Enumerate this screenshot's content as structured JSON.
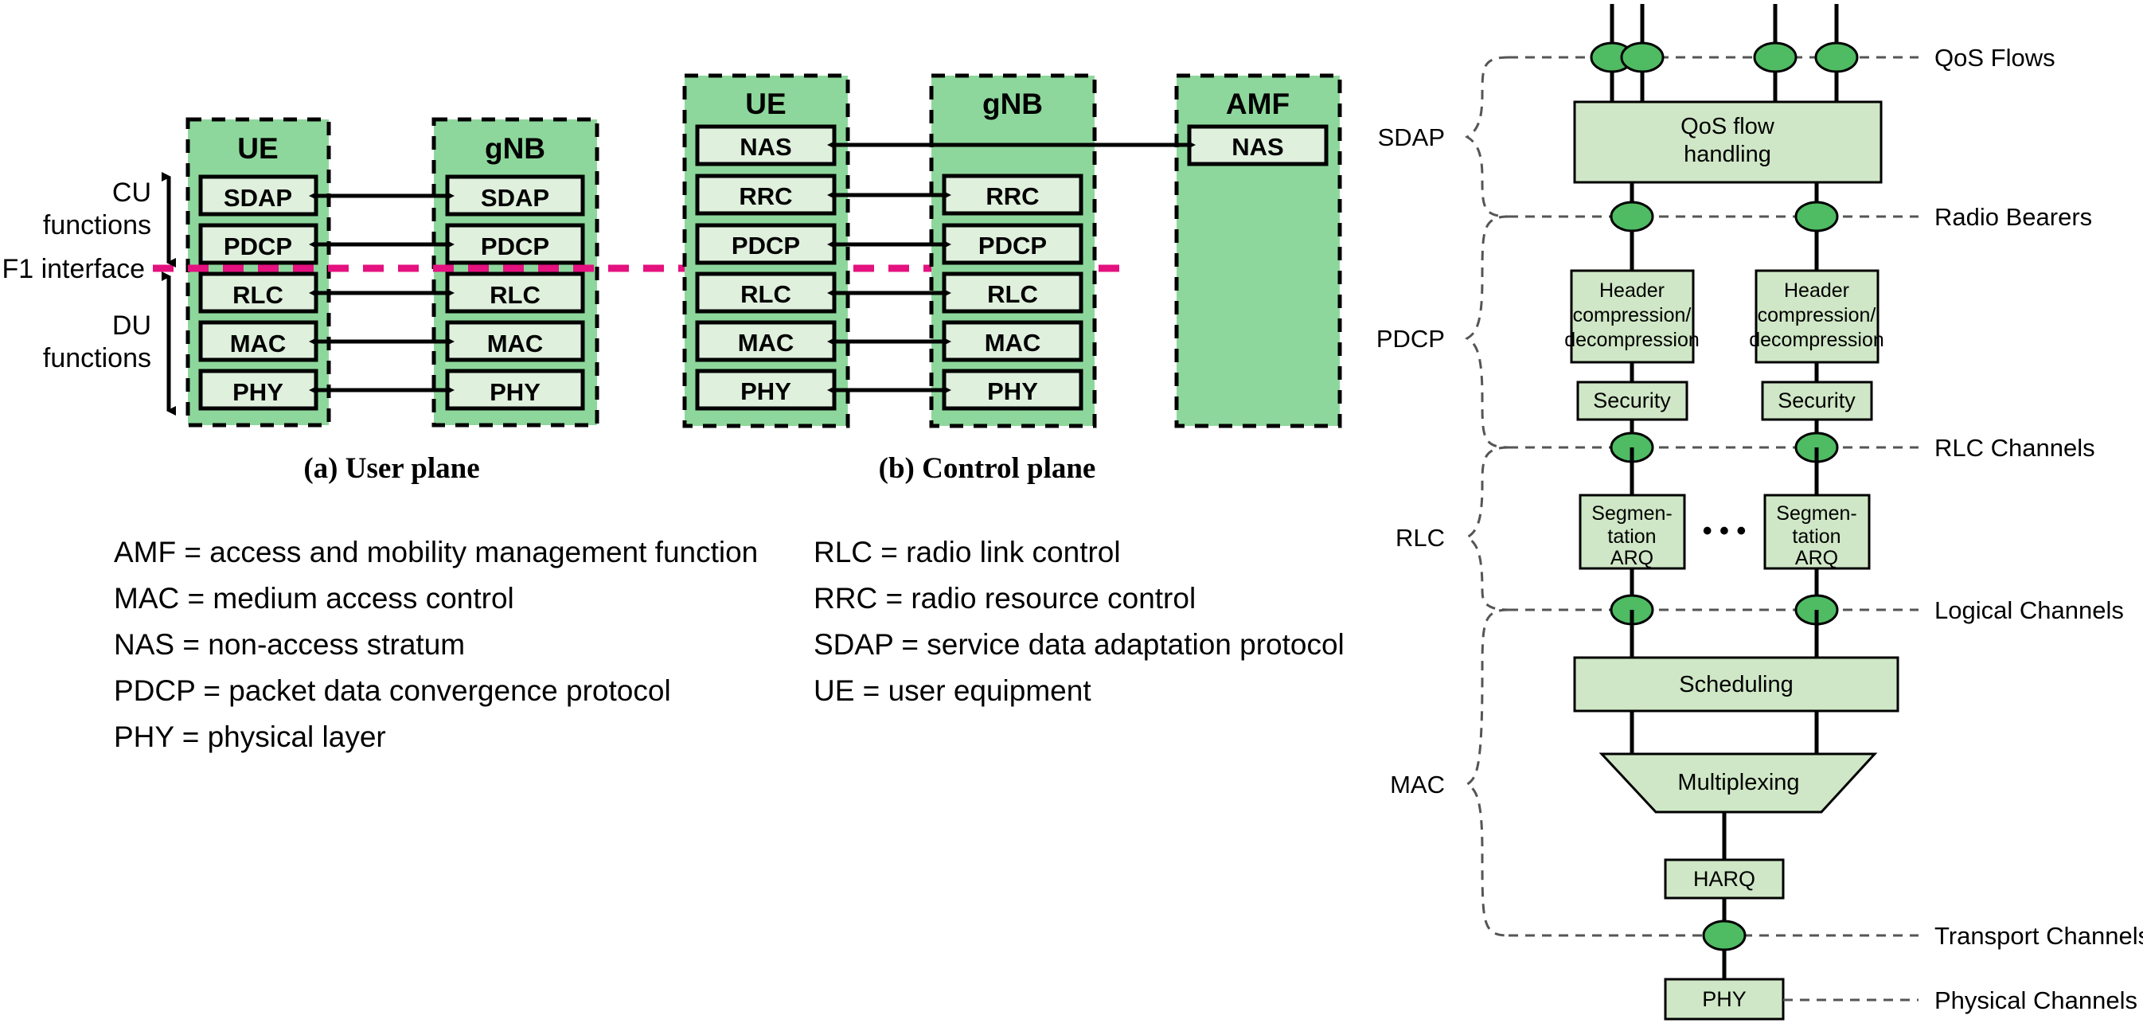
{
  "figure": {
    "panel_a": {
      "caption": "(a) User plane",
      "side_labels": {
        "cu": "CU\nfunctions",
        "cu_line1": "CU",
        "cu_line2": "functions",
        "du_line1": "DU",
        "du_line2": "functions",
        "f1": "F1 interface"
      },
      "nodes": [
        {
          "title": "UE",
          "layers": [
            "SDAP",
            "PDCP",
            "RLC",
            "MAC",
            "PHY"
          ]
        },
        {
          "title": "gNB",
          "layers": [
            "SDAP",
            "PDCP",
            "RLC",
            "MAC",
            "PHY"
          ]
        }
      ],
      "links": [
        "SDAP",
        "PDCP",
        "RLC",
        "MAC",
        "PHY"
      ]
    },
    "panel_b": {
      "caption": "(b) Control plane",
      "nodes": [
        {
          "title": "UE",
          "layers": [
            "NAS",
            "RRC",
            "PDCP",
            "RLC",
            "MAC",
            "PHY"
          ]
        },
        {
          "title": "gNB",
          "layers": [
            "RRC",
            "PDCP",
            "RLC",
            "MAC",
            "PHY"
          ]
        },
        {
          "title": "AMF",
          "layers": [
            "NAS"
          ]
        }
      ],
      "links": [
        "NAS",
        "RRC",
        "PDCP",
        "RLC",
        "MAC",
        "PHY"
      ]
    },
    "legend": {
      "left": [
        "AMF = access and mobility management function",
        "MAC = medium access control",
        "NAS = non-access stratum",
        "PDCP = packet data convergence protocol",
        "PHY = physical layer"
      ],
      "right": [
        "RLC = radio link control",
        "RRC = radio resource control",
        "SDAP = service data adaptation protocol",
        "UE = user equipment"
      ]
    }
  },
  "stack": {
    "layer_labels": [
      "SDAP",
      "PDCP",
      "RLC",
      "MAC"
    ],
    "channel_labels": [
      "QoS Flows",
      "Radio Bearers",
      "RLC Channels",
      "Logical Channels",
      "Transport Channels",
      "Physical Channels"
    ],
    "blocks": {
      "qos": "QoS flow\nhandling",
      "qos_line1": "QoS flow",
      "qos_line2": "handling",
      "header_line1": "Header",
      "header_line2": "compression/",
      "header_line3": "decompression",
      "security": "Security",
      "seg_line1": "Segmen-",
      "seg_line2": "tation",
      "seg_line3": "ARQ",
      "scheduling": "Scheduling",
      "multiplexing": "Multiplexing",
      "harq": "HARQ",
      "phy": "PHY"
    },
    "ellipsis": "• • •"
  },
  "colors": {
    "node_fill": "#8ed79c",
    "layer_fill": "#dff0dd",
    "block_fill": "#cfe7c6",
    "node_green": "#4fbb63",
    "f1_line": "#e4117f",
    "stroke": "#000000",
    "dash_guide": "#555555"
  }
}
